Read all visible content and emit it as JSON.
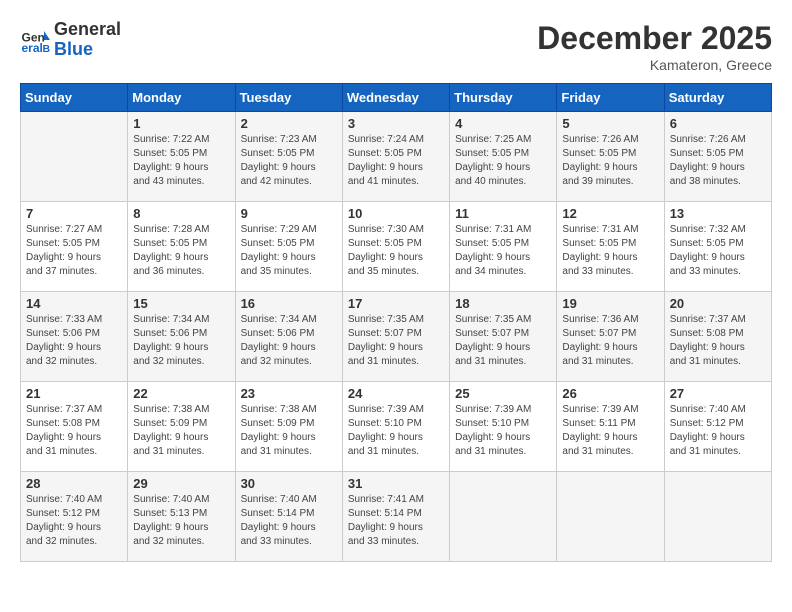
{
  "header": {
    "logo_line1": "General",
    "logo_line2": "Blue",
    "month": "December 2025",
    "location": "Kamateron, Greece"
  },
  "weekdays": [
    "Sunday",
    "Monday",
    "Tuesday",
    "Wednesday",
    "Thursday",
    "Friday",
    "Saturday"
  ],
  "weeks": [
    [
      {
        "day": "",
        "info": ""
      },
      {
        "day": "1",
        "info": "Sunrise: 7:22 AM\nSunset: 5:05 PM\nDaylight: 9 hours\nand 43 minutes."
      },
      {
        "day": "2",
        "info": "Sunrise: 7:23 AM\nSunset: 5:05 PM\nDaylight: 9 hours\nand 42 minutes."
      },
      {
        "day": "3",
        "info": "Sunrise: 7:24 AM\nSunset: 5:05 PM\nDaylight: 9 hours\nand 41 minutes."
      },
      {
        "day": "4",
        "info": "Sunrise: 7:25 AM\nSunset: 5:05 PM\nDaylight: 9 hours\nand 40 minutes."
      },
      {
        "day": "5",
        "info": "Sunrise: 7:26 AM\nSunset: 5:05 PM\nDaylight: 9 hours\nand 39 minutes."
      },
      {
        "day": "6",
        "info": "Sunrise: 7:26 AM\nSunset: 5:05 PM\nDaylight: 9 hours\nand 38 minutes."
      }
    ],
    [
      {
        "day": "7",
        "info": "Sunrise: 7:27 AM\nSunset: 5:05 PM\nDaylight: 9 hours\nand 37 minutes."
      },
      {
        "day": "8",
        "info": "Sunrise: 7:28 AM\nSunset: 5:05 PM\nDaylight: 9 hours\nand 36 minutes."
      },
      {
        "day": "9",
        "info": "Sunrise: 7:29 AM\nSunset: 5:05 PM\nDaylight: 9 hours\nand 35 minutes."
      },
      {
        "day": "10",
        "info": "Sunrise: 7:30 AM\nSunset: 5:05 PM\nDaylight: 9 hours\nand 35 minutes."
      },
      {
        "day": "11",
        "info": "Sunrise: 7:31 AM\nSunset: 5:05 PM\nDaylight: 9 hours\nand 34 minutes."
      },
      {
        "day": "12",
        "info": "Sunrise: 7:31 AM\nSunset: 5:05 PM\nDaylight: 9 hours\nand 33 minutes."
      },
      {
        "day": "13",
        "info": "Sunrise: 7:32 AM\nSunset: 5:05 PM\nDaylight: 9 hours\nand 33 minutes."
      }
    ],
    [
      {
        "day": "14",
        "info": "Sunrise: 7:33 AM\nSunset: 5:06 PM\nDaylight: 9 hours\nand 32 minutes."
      },
      {
        "day": "15",
        "info": "Sunrise: 7:34 AM\nSunset: 5:06 PM\nDaylight: 9 hours\nand 32 minutes."
      },
      {
        "day": "16",
        "info": "Sunrise: 7:34 AM\nSunset: 5:06 PM\nDaylight: 9 hours\nand 32 minutes."
      },
      {
        "day": "17",
        "info": "Sunrise: 7:35 AM\nSunset: 5:07 PM\nDaylight: 9 hours\nand 31 minutes."
      },
      {
        "day": "18",
        "info": "Sunrise: 7:35 AM\nSunset: 5:07 PM\nDaylight: 9 hours\nand 31 minutes."
      },
      {
        "day": "19",
        "info": "Sunrise: 7:36 AM\nSunset: 5:07 PM\nDaylight: 9 hours\nand 31 minutes."
      },
      {
        "day": "20",
        "info": "Sunrise: 7:37 AM\nSunset: 5:08 PM\nDaylight: 9 hours\nand 31 minutes."
      }
    ],
    [
      {
        "day": "21",
        "info": "Sunrise: 7:37 AM\nSunset: 5:08 PM\nDaylight: 9 hours\nand 31 minutes."
      },
      {
        "day": "22",
        "info": "Sunrise: 7:38 AM\nSunset: 5:09 PM\nDaylight: 9 hours\nand 31 minutes."
      },
      {
        "day": "23",
        "info": "Sunrise: 7:38 AM\nSunset: 5:09 PM\nDaylight: 9 hours\nand 31 minutes."
      },
      {
        "day": "24",
        "info": "Sunrise: 7:39 AM\nSunset: 5:10 PM\nDaylight: 9 hours\nand 31 minutes."
      },
      {
        "day": "25",
        "info": "Sunrise: 7:39 AM\nSunset: 5:10 PM\nDaylight: 9 hours\nand 31 minutes."
      },
      {
        "day": "26",
        "info": "Sunrise: 7:39 AM\nSunset: 5:11 PM\nDaylight: 9 hours\nand 31 minutes."
      },
      {
        "day": "27",
        "info": "Sunrise: 7:40 AM\nSunset: 5:12 PM\nDaylight: 9 hours\nand 31 minutes."
      }
    ],
    [
      {
        "day": "28",
        "info": "Sunrise: 7:40 AM\nSunset: 5:12 PM\nDaylight: 9 hours\nand 32 minutes."
      },
      {
        "day": "29",
        "info": "Sunrise: 7:40 AM\nSunset: 5:13 PM\nDaylight: 9 hours\nand 32 minutes."
      },
      {
        "day": "30",
        "info": "Sunrise: 7:40 AM\nSunset: 5:14 PM\nDaylight: 9 hours\nand 33 minutes."
      },
      {
        "day": "31",
        "info": "Sunrise: 7:41 AM\nSunset: 5:14 PM\nDaylight: 9 hours\nand 33 minutes."
      },
      {
        "day": "",
        "info": ""
      },
      {
        "day": "",
        "info": ""
      },
      {
        "day": "",
        "info": ""
      }
    ]
  ]
}
